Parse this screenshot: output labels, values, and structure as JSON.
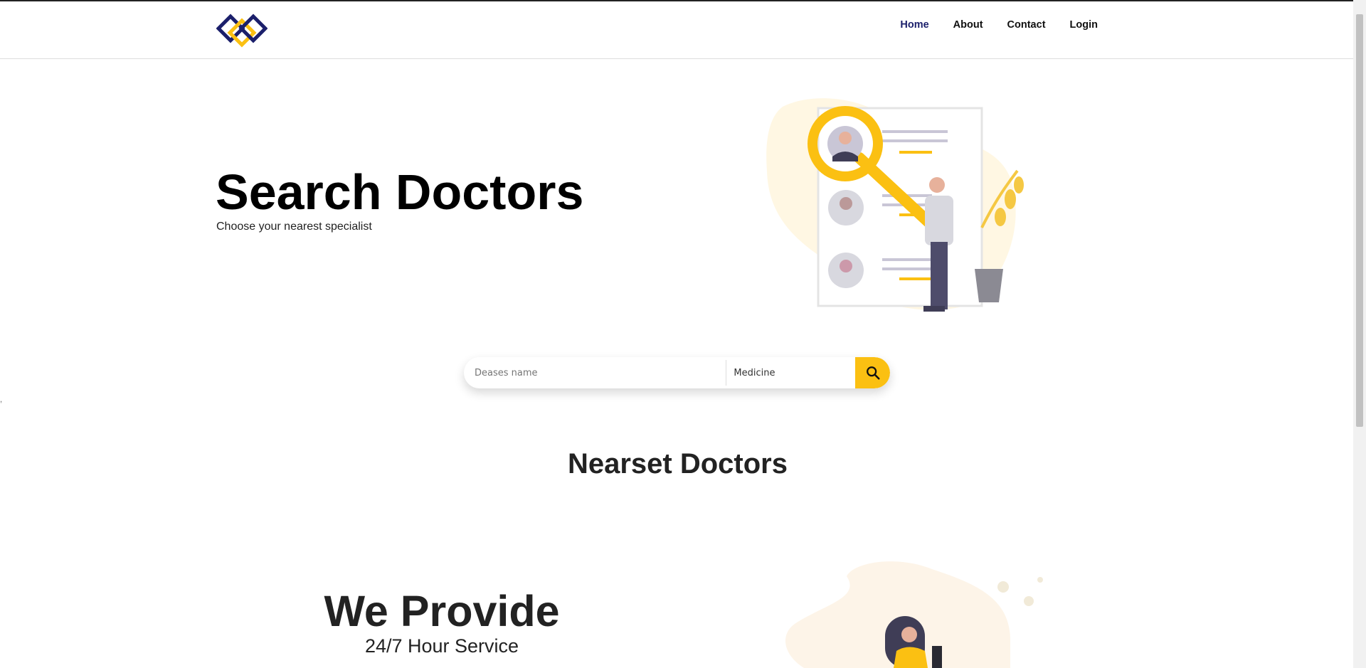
{
  "nav": {
    "items": [
      {
        "label": "Home",
        "active": true
      },
      {
        "label": "About",
        "active": false
      },
      {
        "label": "Contact",
        "active": false
      },
      {
        "label": "Login",
        "active": false
      }
    ]
  },
  "hero": {
    "title": "Search Doctors",
    "subtitle": "Choose your nearest specialist"
  },
  "search": {
    "disease_placeholder": "Deases name",
    "specialty_value": "Medicine",
    "button_icon": "search-icon"
  },
  "misc": {
    "stray_mark": ","
  },
  "nearest": {
    "title": "Nearset Doctors"
  },
  "provide": {
    "title": "We Provide",
    "subtitle": "24/7 Hour Service"
  },
  "colors": {
    "brand_navy": "#1b1f6b",
    "brand_yellow": "#fbc012",
    "text_dark": "#222222"
  }
}
